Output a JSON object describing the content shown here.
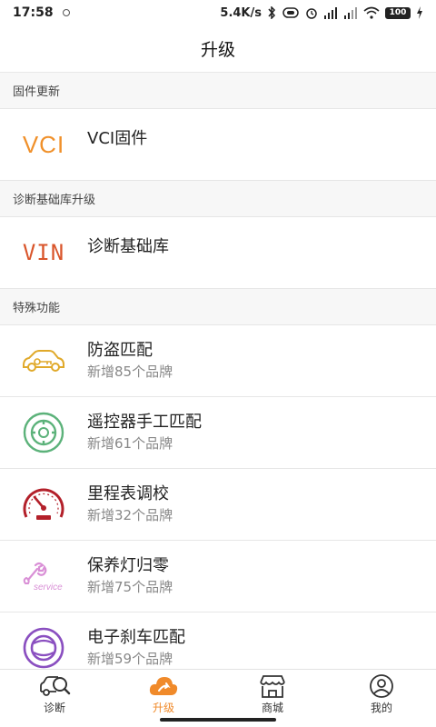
{
  "status_bar": {
    "time": "17:58",
    "network_speed": "5.4K/s",
    "battery": "100"
  },
  "header": {
    "title": "升级"
  },
  "sections": {
    "firmware": {
      "title": "固件更新",
      "item": {
        "icon_text": "VCI",
        "title": "VCI固件"
      }
    },
    "diagnosis": {
      "title": "诊断基础库升级",
      "item": {
        "icon_text": "VIN",
        "title": "诊断基础库"
      }
    },
    "special": {
      "title": "特殊功能",
      "items": [
        {
          "title": "防盗匹配",
          "sub": "新增85个品牌",
          "icon": "car-key-icon"
        },
        {
          "title": "遥控器手工匹配",
          "sub": "新增61个品牌",
          "icon": "remote-control-icon"
        },
        {
          "title": "里程表调校",
          "sub": "新增32个品牌",
          "icon": "odometer-icon"
        },
        {
          "title": "保养灯归零",
          "sub": "新增75个品牌",
          "icon": "service-wrench-icon",
          "icon_text": "service"
        },
        {
          "title": "电子刹车匹配",
          "sub": "新增59个品牌",
          "icon": "brake-icon"
        }
      ]
    }
  },
  "tabbar": {
    "items": [
      {
        "label": "诊断",
        "icon": "car-search-icon"
      },
      {
        "label": "升级",
        "icon": "cloud-upgrade-icon",
        "active": true
      },
      {
        "label": "商城",
        "icon": "shop-icon"
      },
      {
        "label": "我的",
        "icon": "user-icon"
      }
    ]
  },
  "colors": {
    "accent": "#f08a2a",
    "vin": "#d9552b",
    "car_key": "#e0a92a",
    "remote": "#5cb27a",
    "odometer": "#b3202a",
    "service": "#d98fd6",
    "brake": "#8a4fc0"
  }
}
